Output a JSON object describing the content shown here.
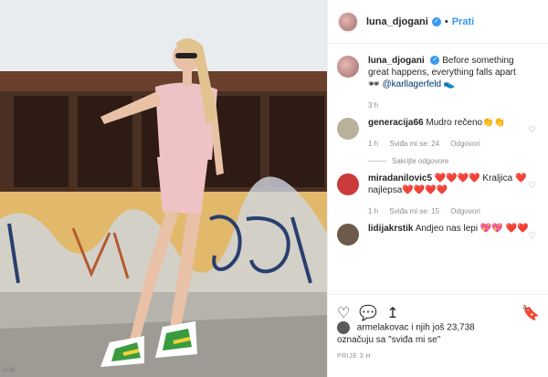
{
  "header": {
    "username": "luna_djogani",
    "verified_icon": "verified-badge-icon",
    "separator": "•",
    "follow_label": "Prati"
  },
  "caption": {
    "username": "luna_djogani",
    "text": "Before something great happens, everything falls apart",
    "emoji_left": "🕶",
    "mention": "@karllagerfeld",
    "emoji_right": "👟",
    "time": "3 h"
  },
  "comments": [
    {
      "username": "generacija66",
      "text": "Mudro rečeno👏👏",
      "time": "1 h",
      "likes": "Sviđa mi se: 24",
      "reply": "Odgovori",
      "hide_replies": "Sakrijte odgovore"
    },
    {
      "username": "miradanilovic5",
      "text": "❤️❤️❤️❤️ Kraljica ❤️najlepsa❤️❤️❤️❤️",
      "time": "1 h",
      "likes": "Sviđa mi se: 15",
      "reply": "Odgovori"
    },
    {
      "username": "lidijakrstik",
      "text": "Andjeo nas lepi 💖💖 ❤️❤️"
    }
  ],
  "likes": {
    "line1": "armelakovac i njih još 23,738",
    "line2": "označuju sa \"sviđa mi se\""
  },
  "date": "PRIJE 3 H",
  "watermark": "01/8/",
  "icons": {
    "like": "heart-outline-icon",
    "comment": "comment-icon",
    "share": "share-icon",
    "save": "bookmark-icon"
  },
  "colors": {
    "accent": "#3897f0",
    "muted": "#8e8e8e",
    "text": "#262626"
  }
}
